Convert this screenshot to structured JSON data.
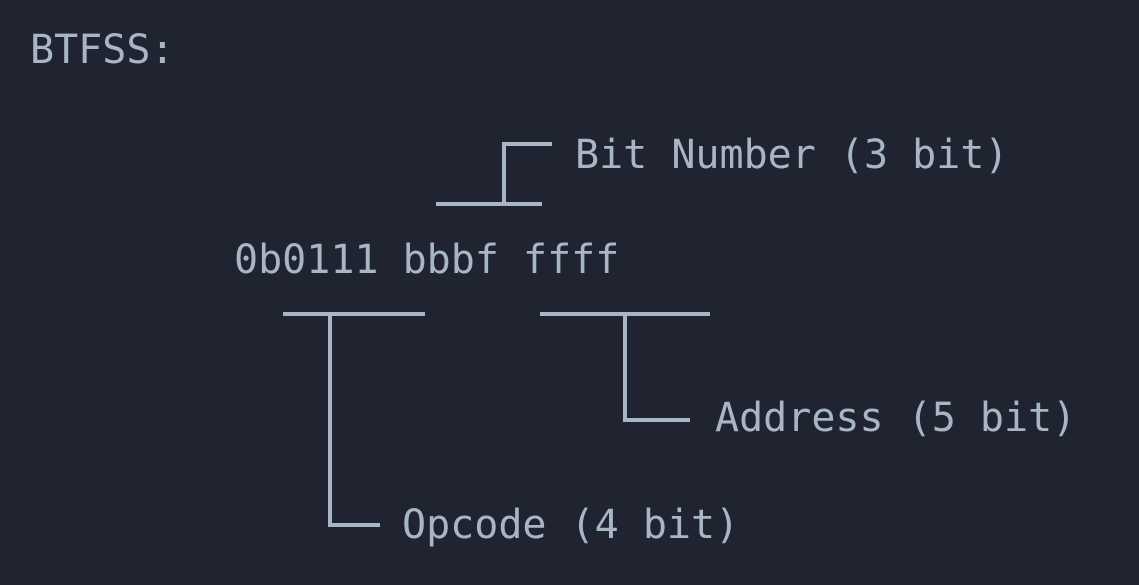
{
  "title": "BTFSS:",
  "encoding": {
    "pattern": "0b0111 bbbf ffff",
    "opcode_token": "0111",
    "bitnum_token": "bbb",
    "address_token": "f ffff"
  },
  "fields": {
    "bit_number": {
      "label": "Bit Number (3 bit)",
      "bits": 3
    },
    "address": {
      "label": "Address (5 bit)",
      "bits": 5
    },
    "opcode": {
      "label": "Opcode (4 bit)",
      "bits": 4
    }
  }
}
